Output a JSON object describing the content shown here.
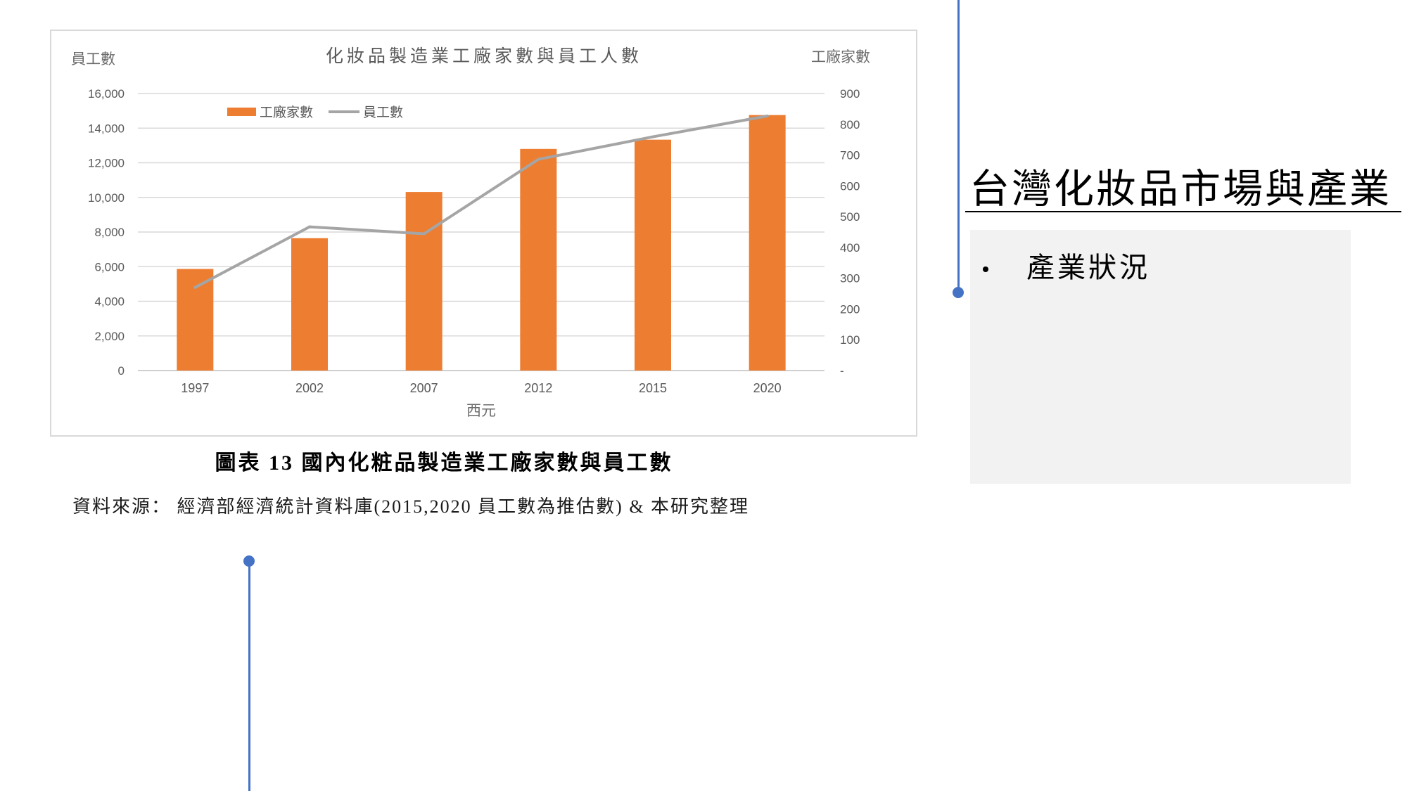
{
  "chart_data": {
    "type": "bar",
    "title": "化妝品製造業工廠家數與員工人數",
    "xlabel": "西元",
    "ylabel": "員工數",
    "y2label": "工廠家數",
    "categories": [
      "1997",
      "2002",
      "2007",
      "2012",
      "2015",
      "2020"
    ],
    "series": [
      {
        "name": "工廠家數",
        "type": "bar",
        "axis": "right",
        "color": "#ED7D31",
        "values": [
          330,
          430,
          580,
          720,
          750,
          830
        ]
      },
      {
        "name": "員工數",
        "type": "line",
        "axis": "left",
        "color": "#A5A5A5",
        "values": [
          4800,
          8300,
          7900,
          12200,
          13500,
          14700
        ]
      }
    ],
    "ylim": [
      0,
      16000
    ],
    "yticks": [
      0,
      2000,
      4000,
      6000,
      8000,
      10000,
      12000,
      14000,
      16000
    ],
    "ytick_labels": [
      "0",
      "2,000",
      "4,000",
      "6,000",
      "8,000",
      "10,000",
      "12,000",
      "14,000",
      "16,000"
    ],
    "y2lim": [
      0,
      900
    ],
    "y2ticks": [
      0,
      100,
      200,
      300,
      400,
      500,
      600,
      700,
      800,
      900
    ],
    "y2tick_labels": [
      "-",
      "100",
      "200",
      "300",
      "400",
      "500",
      "600",
      "700",
      "800",
      "900"
    ],
    "grid": true,
    "legend": "top-left"
  },
  "figure": {
    "caption": "圖表 13 國內化粧品製造業工廠家數與員工數",
    "source": "資料來源： 經濟部經濟統計資料庫(2015,2020 員工數為推估數) & 本研究整理"
  },
  "slide": {
    "title": "台灣化妝品市場與產業",
    "bullets": [
      "產業狀況"
    ]
  },
  "colors": {
    "accent": "#4472C4",
    "panel": "#F2F2F2",
    "gridline": "#D9D9D9",
    "axis_text": "#595959"
  }
}
